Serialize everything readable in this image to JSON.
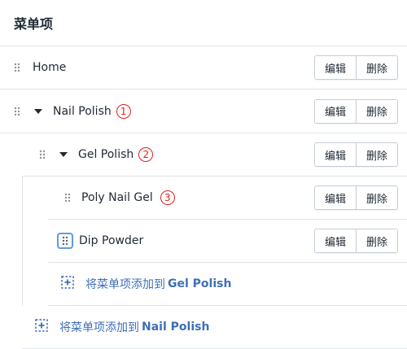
{
  "header": {
    "title": "菜单项"
  },
  "buttons": {
    "edit": "编辑",
    "delete": "删除"
  },
  "items": [
    {
      "label": "Home"
    },
    {
      "label": "Nail Polish",
      "badge": "1"
    },
    {
      "label": "Gel Polish",
      "badge": "2"
    },
    {
      "label": "Poly Nail Gel",
      "badge": "3"
    },
    {
      "label": "Dip Powder"
    }
  ],
  "add_links": [
    {
      "prefix": "将菜单项添加到",
      "target": "Gel Polish"
    },
    {
      "prefix": "将菜单项添加到",
      "target": "Nail Polish"
    }
  ],
  "colors": {
    "link": "#3f6fb5",
    "badge": "#e02020",
    "focus": "#5c9ce6",
    "border": "#dfe3e8"
  }
}
